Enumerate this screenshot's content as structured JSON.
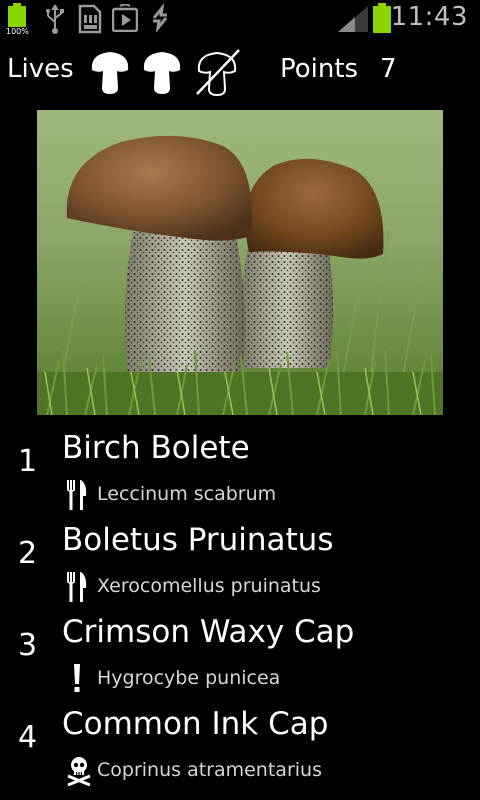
{
  "status_bar": {
    "battery_percent": "100%",
    "time": "11:43",
    "icons": [
      "battery-icon",
      "usb-icon",
      "sd-card-icon",
      "play-store-icon",
      "sync-icon",
      "signal-icon",
      "battery-icon"
    ]
  },
  "game": {
    "lives_label": "Lives",
    "lives_total": 3,
    "lives_remaining": 2,
    "points_label": "Points",
    "points_value": "7"
  },
  "photo": {
    "subject_icon": "mushroom-photo"
  },
  "options": [
    {
      "number": "1",
      "name": "Birch Bolete",
      "latin": "Leccinum scabrum",
      "edibility_icon": "fork-knife-icon"
    },
    {
      "number": "2",
      "name": "Boletus Pruinatus",
      "latin": "Xerocomellus pruinatus",
      "edibility_icon": "fork-knife-icon"
    },
    {
      "number": "3",
      "name": "Crimson Waxy Cap",
      "latin": "Hygrocybe punicea",
      "edibility_icon": "exclamation-icon"
    },
    {
      "number": "4",
      "name": "Common Ink Cap",
      "latin": "Coprinus atramentarius",
      "edibility_icon": "skull-icon"
    }
  ],
  "colors": {
    "background": "#000000",
    "battery_green": "#8bd400",
    "clock_gray": "#bfbfbf"
  }
}
